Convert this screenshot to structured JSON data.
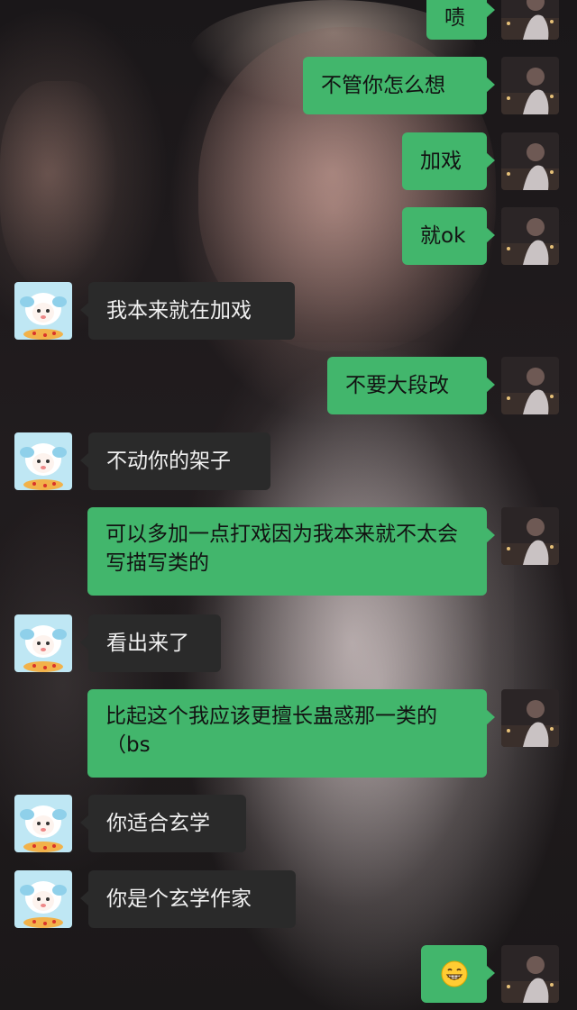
{
  "theme": {
    "sent_bubble_color": "#42b66c",
    "received_bubble_color": "#2a2a2a",
    "received_text_color": "#f0f0f0",
    "sent_text_color": "#121212"
  },
  "background": {
    "icon": "photo-wallpaper"
  },
  "avatars": {
    "me": {
      "icon": "dark-photo-avatar"
    },
    "them": {
      "icon": "cartoon-sheep-avatar"
    }
  },
  "messages": [
    {
      "side": "me",
      "text": "啧"
    },
    {
      "side": "me",
      "text": "不管你怎么想"
    },
    {
      "side": "me",
      "text": "加戏"
    },
    {
      "side": "me",
      "text": "就ok"
    },
    {
      "side": "them",
      "text": "我本来就在加戏"
    },
    {
      "side": "me",
      "text": "不要大段改"
    },
    {
      "side": "them",
      "text": "不动你的架子"
    },
    {
      "side": "me",
      "text": "可以多加一点打戏因为我本来就不太会写描写类的"
    },
    {
      "side": "them",
      "text": "看出来了"
    },
    {
      "side": "me",
      "text": "比起这个我应该更擅长蛊惑那一类的（bs"
    },
    {
      "side": "them",
      "text": "你适合玄学"
    },
    {
      "side": "them",
      "text": "你是个玄学作家"
    },
    {
      "side": "me",
      "text": "",
      "emoji": "grinning-face-emoji"
    }
  ]
}
